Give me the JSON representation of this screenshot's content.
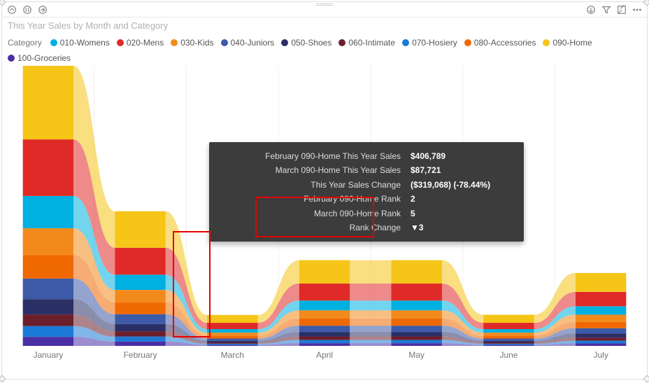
{
  "title": "This Year Sales by Month and Category",
  "legend_label": "Category",
  "categories": [
    {
      "name": "010-Womens",
      "color": "#00b0e0"
    },
    {
      "name": "020-Mens",
      "color": "#e02a28"
    },
    {
      "name": "030-Kids",
      "color": "#f28a1b"
    },
    {
      "name": "040-Juniors",
      "color": "#3c5aa8"
    },
    {
      "name": "050-Shoes",
      "color": "#2a2f66"
    },
    {
      "name": "060-Intimate",
      "color": "#6b1f2c"
    },
    {
      "name": "070-Hosiery",
      "color": "#1a7ad6"
    },
    {
      "name": "080-Accessories",
      "color": "#f06800"
    },
    {
      "name": "090-Home",
      "color": "#f5c518"
    },
    {
      "name": "100-Groceries",
      "color": "#4b2fa5"
    }
  ],
  "months": [
    "January",
    "February",
    "March",
    "April",
    "May",
    "June",
    "July"
  ],
  "tooltip": {
    "rows": [
      {
        "k": "February 090-Home This Year Sales",
        "v": "$406,789"
      },
      {
        "k": "March 090-Home This Year Sales",
        "v": "$87,721"
      },
      {
        "k": "This Year Sales Change",
        "v": "($319,068) (-78.44%)"
      },
      {
        "k": "February 090-Home Rank",
        "v": "2"
      },
      {
        "k": "March 090-Home Rank",
        "v": "5"
      },
      {
        "k": "Rank Change",
        "v": "▼3"
      }
    ]
  },
  "chart_data": {
    "type": "area",
    "note": "Stacked ribbon chart; values are approximate This Year Sales per category per month, read from relative band heights.",
    "months": [
      "January",
      "February",
      "March",
      "April",
      "May",
      "June",
      "July"
    ],
    "series": [
      {
        "name": "010-Womens",
        "color": "#00b0e0",
        "values": [
          360000,
          170000,
          40000,
          110000,
          110000,
          40000,
          95000
        ]
      },
      {
        "name": "020-Mens",
        "color": "#e02a28",
        "values": [
          630000,
          300000,
          70000,
          190000,
          190000,
          70000,
          160000
        ]
      },
      {
        "name": "030-Kids",
        "color": "#f28a1b",
        "values": [
          300000,
          140000,
          35000,
          90000,
          90000,
          35000,
          80000
        ]
      },
      {
        "name": "040-Juniors",
        "color": "#3c5aa8",
        "values": [
          230000,
          110000,
          25000,
          70000,
          70000,
          25000,
          60000
        ]
      },
      {
        "name": "050-Shoes",
        "color": "#2a2f66",
        "values": [
          170000,
          80000,
          18000,
          50000,
          50000,
          18000,
          45000
        ]
      },
      {
        "name": "060-Intimate",
        "color": "#6b1f2c",
        "values": [
          130000,
          60000,
          15000,
          40000,
          40000,
          15000,
          35000
        ]
      },
      {
        "name": "070-Hosiery",
        "color": "#1a7ad6",
        "values": [
          120000,
          55000,
          13000,
          35000,
          35000,
          13000,
          30000
        ]
      },
      {
        "name": "080-Accessories",
        "color": "#f06800",
        "values": [
          260000,
          130000,
          30000,
          80000,
          80000,
          30000,
          70000
        ]
      },
      {
        "name": "090-Home",
        "color": "#f5c518",
        "values": [
          820000,
          406789,
          87721,
          260000,
          260000,
          90000,
          210000
        ]
      },
      {
        "name": "100-Groceries",
        "color": "#4b2fa5",
        "values": [
          100000,
          48000,
          11000,
          30000,
          30000,
          11000,
          27000
        ]
      }
    ],
    "ranks_feb_mar": {
      "090-Home": {
        "feb": 2,
        "mar": 5,
        "change": -3
      }
    }
  }
}
